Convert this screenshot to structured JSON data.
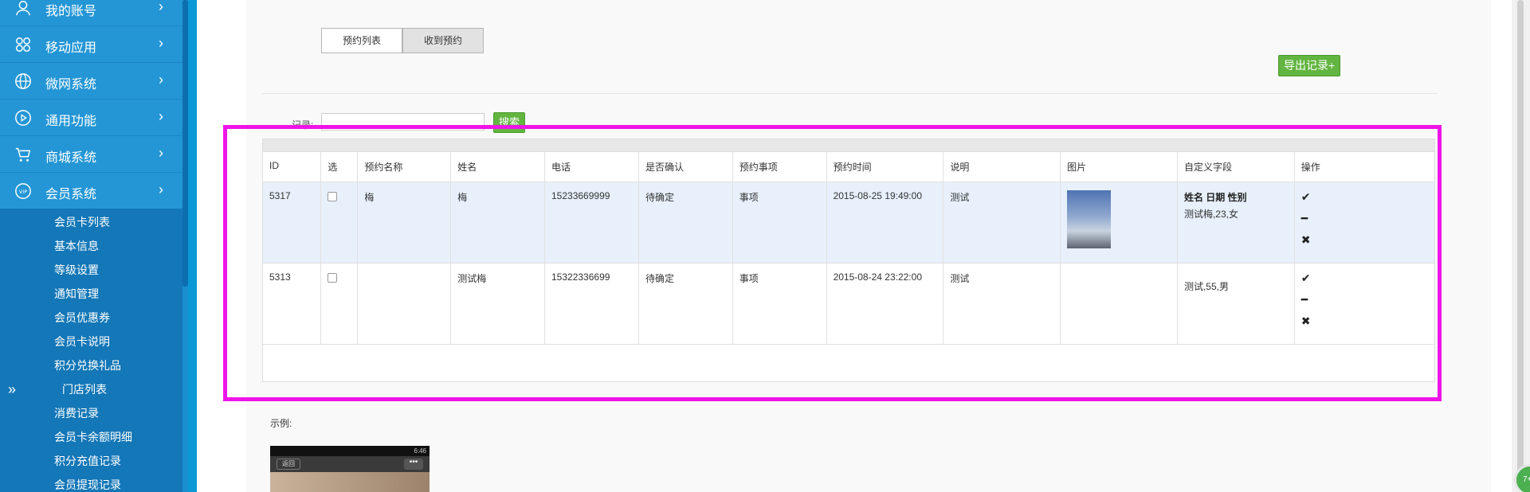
{
  "sidebar": {
    "menu": [
      {
        "label": "我的账号",
        "icon": "user-icon"
      },
      {
        "label": "移动应用",
        "icon": "apps-icon"
      },
      {
        "label": "微网系统",
        "icon": "globe-icon"
      },
      {
        "label": "通用功能",
        "icon": "play-circle-icon"
      },
      {
        "label": "商城系统",
        "icon": "cart-icon"
      },
      {
        "label": "会员系统",
        "icon": "vip-icon"
      }
    ],
    "submenu": [
      "会员卡列表",
      "基本信息",
      "等级设置",
      "通知管理",
      "会员优惠券",
      "会员卡说明",
      "积分兑换礼品",
      "门店列表",
      "消费记录",
      "会员卡余额明细",
      "积分充值记录",
      "会员提现记录"
    ],
    "collapse_symbol": "»",
    "chevron": "›"
  },
  "tabs": [
    "预约列表",
    "收到预约"
  ],
  "export_label": "导出记录+",
  "search": {
    "label": "记录:",
    "button": "搜索"
  },
  "table": {
    "headers": [
      "ID",
      "选",
      "预约名称",
      "姓名",
      "电话",
      "是否确认",
      "预约事项",
      "预约时间",
      "说明",
      "图片",
      "自定义字段",
      "操作"
    ],
    "rows": [
      {
        "id": "5317",
        "name": "梅",
        "person": "梅",
        "phone": "15233669999",
        "confirm": "待确定",
        "item": "事项",
        "time": "2015-08-25 19:49:00",
        "note": "测试",
        "custom_title": "姓名 日期 性别",
        "custom_value": "测试梅,23,女"
      },
      {
        "id": "5313",
        "name": "",
        "person": "测试梅",
        "phone": "15322336699",
        "confirm": "待确定",
        "item": "事项",
        "time": "2015-08-24 23:22:00",
        "note": "测试",
        "custom_title": "",
        "custom_value": "测试,55,男"
      }
    ],
    "ops": [
      "✔",
      "━",
      "✖"
    ]
  },
  "example_label": "示例:",
  "phone_preview": {
    "back": "返回",
    "more": "•••",
    "time": "6:46"
  },
  "chat_badge": "7+",
  "colors": {
    "sidebar": "#1c8fd0",
    "highlight": "#ef14e8",
    "green": "#62b540"
  }
}
